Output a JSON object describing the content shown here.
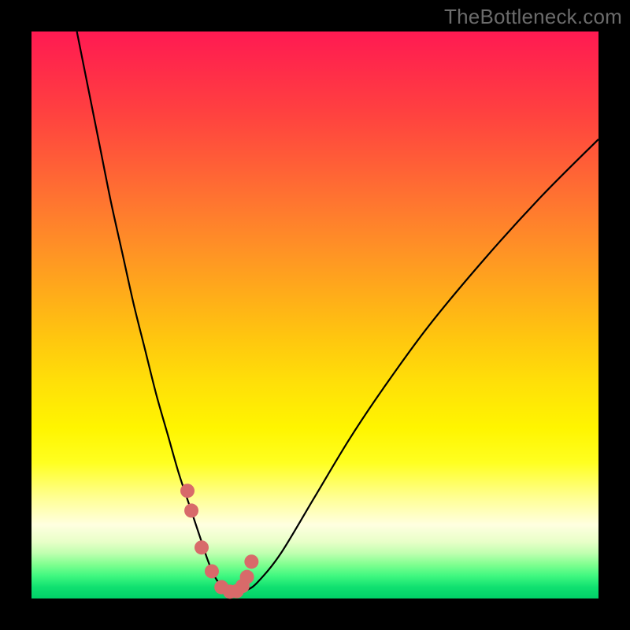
{
  "watermark": "TheBottleneck.com",
  "colors": {
    "background": "#000000",
    "curve_stroke": "#000000",
    "marker_fill": "#d86a6a",
    "marker_stroke": "#c95858"
  },
  "chart_data": {
    "type": "line",
    "title": "",
    "xlabel": "",
    "ylabel": "",
    "xlim": [
      0,
      100
    ],
    "ylim": [
      0,
      100
    ],
    "series": [
      {
        "name": "bottleneck-curve",
        "x": [
          8,
          10,
          12,
          14,
          16,
          18,
          20,
          22,
          24,
          26,
          28,
          30,
          31,
          32,
          33,
          34,
          35,
          36,
          38,
          40,
          44,
          50,
          56,
          62,
          70,
          80,
          90,
          100
        ],
        "y": [
          100,
          90,
          80,
          70,
          61,
          52,
          44,
          36,
          29,
          22,
          16,
          10,
          7,
          4.5,
          2.8,
          1.8,
          1.2,
          1.0,
          1.5,
          3,
          8,
          18,
          28,
          37,
          48,
          60,
          71,
          81
        ]
      }
    ],
    "markers": {
      "name": "highlight-points",
      "x": [
        27.5,
        28.2,
        30.0,
        31.8,
        33.5,
        35.0,
        36.2,
        37.2,
        38.0,
        38.8
      ],
      "y": [
        19.0,
        15.5,
        9.0,
        4.8,
        2.0,
        1.2,
        1.3,
        2.2,
        3.8,
        6.5
      ]
    }
  }
}
